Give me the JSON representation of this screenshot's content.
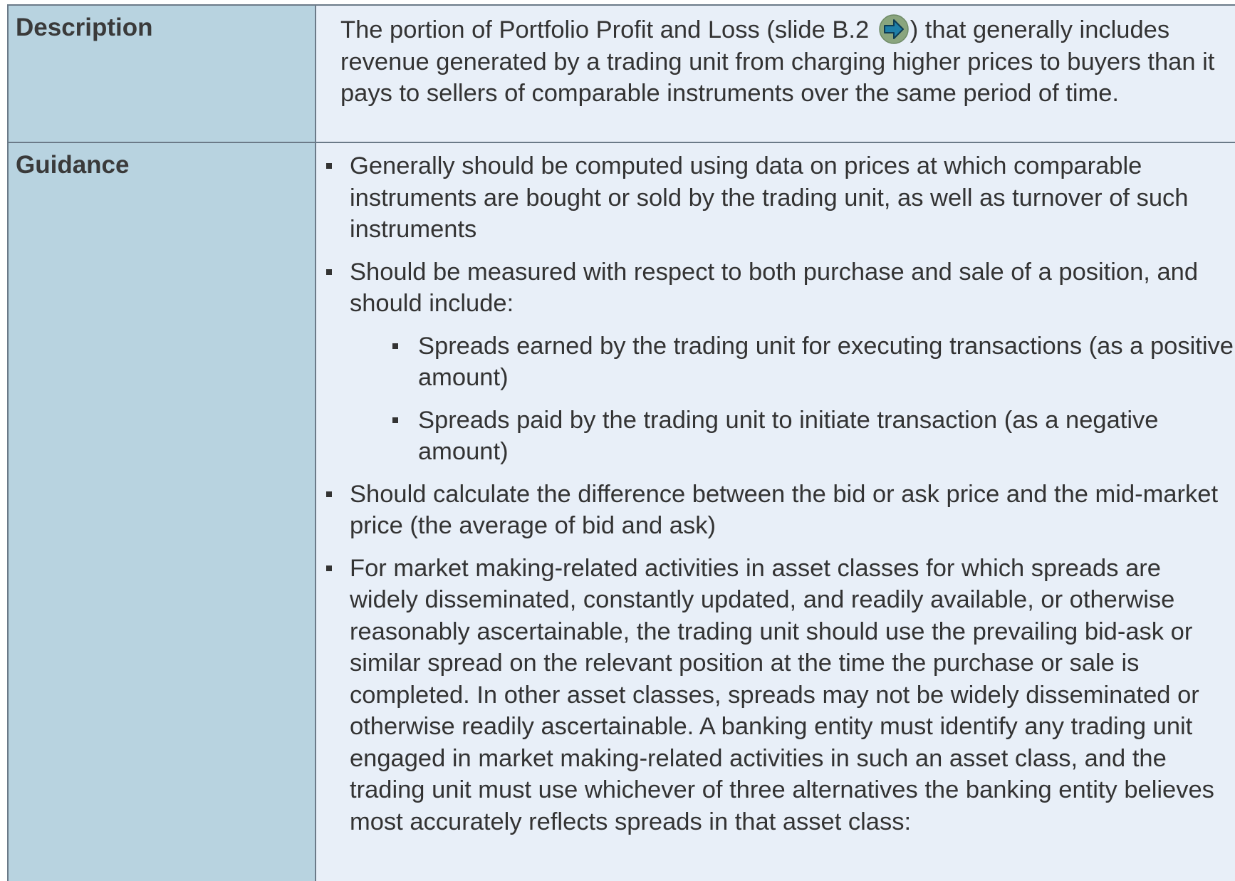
{
  "description": {
    "label": "Description",
    "text_before": "The portion of Portfolio Profit and Loss (slide B.2 ",
    "link_icon": "arrow-right-icon",
    "text_after": ") that generally includes revenue generated by a trading unit from charging higher prices to buyers than it pays to sellers of comparable instruments over the same period of time."
  },
  "guidance": {
    "label": "Guidance",
    "items": [
      "Generally should be computed using data on prices at which comparable instruments are bought or sold by the trading unit, as well as turnover of such instruments",
      "Should be measured with respect to both purchase and sale of a position, and should include:",
      "Should calculate the difference between the bid or ask price and the mid-market price (the average of bid and ask)",
      "For market making-related activities in asset classes for which spreads are widely disseminated, constantly updated, and readily available, or otherwise reasonably ascertainable, the trading unit should use the prevailing bid-ask or similar spread on the relevant position at the time the purchase or sale is completed.  In other asset classes, spreads may not be widely disseminated or otherwise readily ascertainable.  A banking entity must identify any trading unit engaged in market making-related activities in such an asset class, and the trading unit must use whichever of three alternatives the banking entity believes most accurately reflects spreads in that asset class:"
    ],
    "sub_items": [
      "Spreads earned by the trading unit for executing transactions (as a positive amount)",
      "Spreads paid by the trading unit to initiate transaction (as a negative amount)"
    ]
  },
  "colors": {
    "label_cell_bg": "#b8d3e0",
    "content_cell_bg": "#e8eff8",
    "border": "#6b7a88",
    "arrow_circle": "#8aa57e",
    "arrow_fill": "#1f7fa8"
  }
}
